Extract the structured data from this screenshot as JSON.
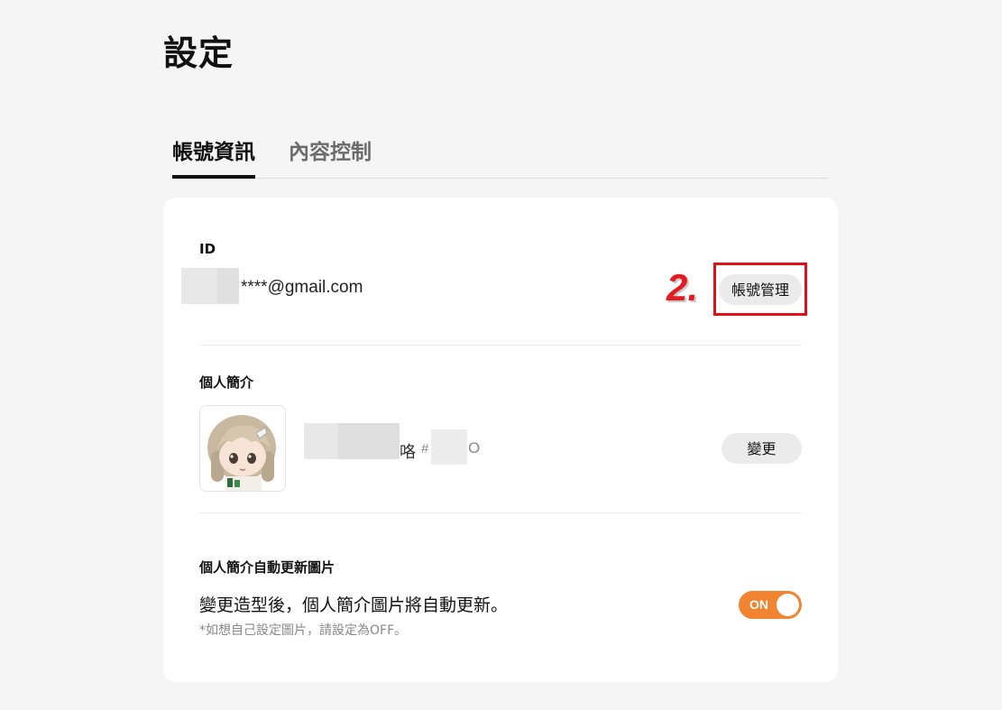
{
  "page": {
    "title": "設定"
  },
  "tabs": [
    {
      "label": "帳號資訊",
      "active": true
    },
    {
      "label": "內容控制",
      "active": false
    }
  ],
  "account": {
    "id_label": "ID",
    "email_masked": "****@gmail.com",
    "manage_button": "帳號管理",
    "annotation_number": "2."
  },
  "profile": {
    "label": "個人簡介",
    "avatar_icon": "character-avatar-icon",
    "nickname_suffix": "咯",
    "tag_prefix": "#",
    "tag_suffix": "O",
    "change_button": "變更"
  },
  "auto_update": {
    "label": "個人簡介自動更新圖片",
    "description": "變更造型後，個人簡介圖片將自動更新。",
    "note": "*如想自己設定圖片，請設定為OFF。",
    "toggle_text": "ON",
    "toggle_color": "#f08430"
  }
}
